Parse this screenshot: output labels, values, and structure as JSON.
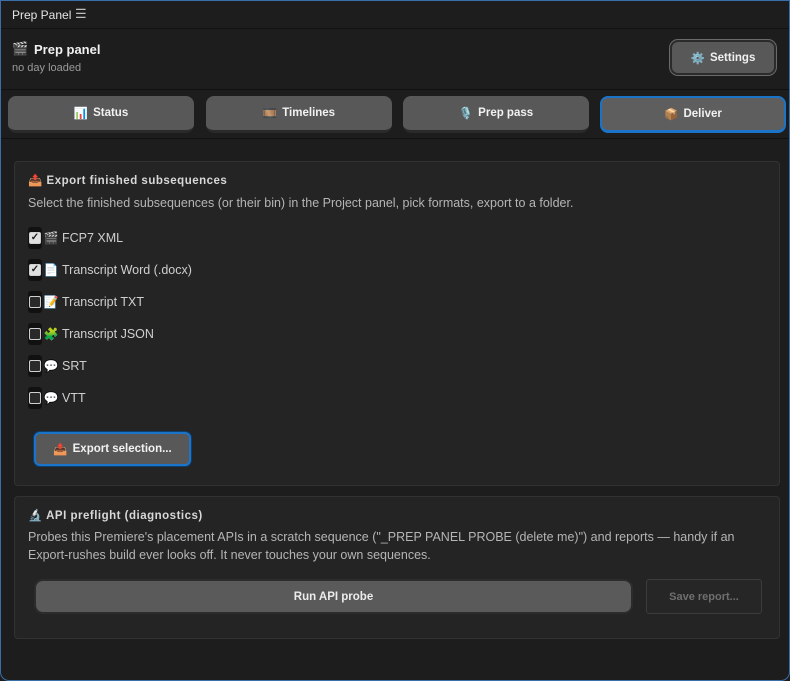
{
  "titlebar": {
    "title": "Prep Panel",
    "menu_icon": "☰"
  },
  "header": {
    "icon": "🎬",
    "title": "Prep panel",
    "subtitle": "no day loaded",
    "settings": {
      "icon": "⚙️",
      "label": "Settings"
    }
  },
  "tabs": [
    {
      "icon": "📊",
      "label": "Status",
      "active": false
    },
    {
      "icon": "🎞️",
      "label": "Timelines",
      "active": false
    },
    {
      "icon": "🎙️",
      "label": "Prep pass",
      "active": false
    },
    {
      "icon": "📦",
      "label": "Deliver",
      "active": true
    }
  ],
  "export_card": {
    "icon": "📤",
    "title": "Export finished subsequences",
    "description": "Select the finished subsequences (or their bin) in the Project panel, pick formats, export to a folder.",
    "options": [
      {
        "icon": "🎬",
        "label": "FCP7 XML",
        "checked": true
      },
      {
        "icon": "📄",
        "label": "Transcript Word (.docx)",
        "checked": true
      },
      {
        "icon": "📝",
        "label": "Transcript TXT",
        "checked": false
      },
      {
        "icon": "🧩",
        "label": "Transcript JSON",
        "checked": false
      },
      {
        "icon": "💬",
        "label": "SRT",
        "checked": false
      },
      {
        "icon": "💬",
        "label": "VTT",
        "checked": false
      }
    ],
    "export_button": {
      "icon": "📤",
      "label": "Export selection..."
    }
  },
  "api_card": {
    "icon": "🔬",
    "title": "API preflight (diagnostics)",
    "description": "Probes this Premiere's placement APIs in a scratch sequence (\"_PREP PANEL PROBE (delete me)\") and reports — handy if an Export-rushes build ever looks off. It never touches your own sequences.",
    "run_button": "Run API probe",
    "save_button": "Save report..."
  }
}
